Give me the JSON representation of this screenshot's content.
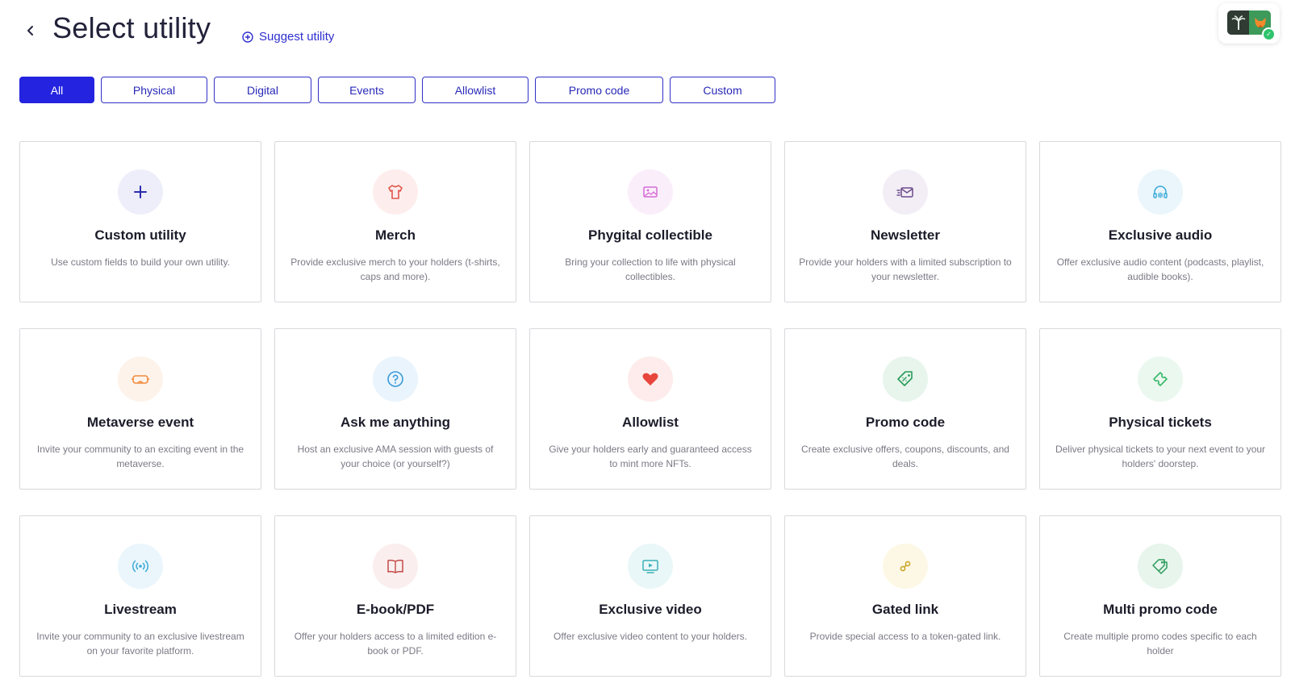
{
  "header": {
    "title": "Select utility",
    "suggest_label": "Suggest utility"
  },
  "filters": [
    {
      "label": "All",
      "active": true
    },
    {
      "label": "Physical",
      "active": false
    },
    {
      "label": "Digital",
      "active": false
    },
    {
      "label": "Events",
      "active": false
    },
    {
      "label": "Allowlist",
      "active": false
    },
    {
      "label": "Promo code",
      "active": false
    },
    {
      "label": "Custom",
      "active": false
    }
  ],
  "cards": [
    {
      "title": "Custom utility",
      "description": "Use custom fields to build your own utility.",
      "icon": "plus-icon",
      "color": "#2b2bb0",
      "bg": "#eeeefb"
    },
    {
      "title": "Merch",
      "description": "Provide exclusive merch to your holders (t-shirts, caps and more).",
      "icon": "tshirt-icon",
      "color": "#e2574c",
      "bg": "#fdeeed"
    },
    {
      "title": "Phygital collectible",
      "description": "Bring your collection to life with physical collectibles.",
      "icon": "image-icon",
      "color": "#d46ad4",
      "bg": "#fbeefb"
    },
    {
      "title": "Newsletter",
      "description": "Provide your holders with a limited subscription to your newsletter.",
      "icon": "envelope-icon",
      "color": "#6b4a8a",
      "bg": "#f3eef6"
    },
    {
      "title": "Exclusive audio",
      "description": "Offer exclusive audio content (podcasts, playlist, audible books).",
      "icon": "headphones-icon",
      "color": "#3aa8d8",
      "bg": "#eaf6fc"
    },
    {
      "title": "Metaverse event",
      "description": "Invite your community to an exciting event in the metaverse.",
      "icon": "vr-headset-icon",
      "color": "#f08a3c",
      "bg": "#fef3ea"
    },
    {
      "title": "Ask me anything",
      "description": "Host an exclusive AMA session with guests of your choice (or yourself?)",
      "icon": "question-icon",
      "color": "#3a9ad8",
      "bg": "#eaf4fc"
    },
    {
      "title": "Allowlist",
      "description": "Give your holders early and guaranteed access to mint more NFTs.",
      "icon": "heart-icon",
      "color": "#e8453c",
      "bg": "#fdeceb"
    },
    {
      "title": "Promo code",
      "description": "Create exclusive offers, coupons, discounts, and deals.",
      "icon": "tag-icon",
      "color": "#2a9a5a",
      "bg": "#e7f5ec"
    },
    {
      "title": "Physical tickets",
      "description": "Deliver physical tickets to your next event to your holders' doorstep.",
      "icon": "ticket-icon",
      "color": "#3ab86a",
      "bg": "#ebf8ef"
    },
    {
      "title": "Livestream",
      "description": "Invite your community to an exclusive livestream on your favorite platform.",
      "icon": "broadcast-icon",
      "color": "#3aa8d8",
      "bg": "#eaf6fc"
    },
    {
      "title": "E-book/PDF",
      "description": "Offer your holders access to a limited edition e-book or PDF.",
      "icon": "book-icon",
      "color": "#c44a4a",
      "bg": "#fbeeee"
    },
    {
      "title": "Exclusive video",
      "description": "Offer exclusive video content to your holders.",
      "icon": "video-icon",
      "color": "#3ab0b8",
      "bg": "#eaf7f8"
    },
    {
      "title": "Gated link",
      "description": "Provide special access to a token-gated link.",
      "icon": "link-icon",
      "color": "#c8a82a",
      "bg": "#fdf8e6"
    },
    {
      "title": "Multi promo code",
      "description": "Create multiple promo codes specific to each holder",
      "icon": "multi-tag-icon",
      "color": "#2a9a5a",
      "bg": "#e7f5ec"
    }
  ]
}
